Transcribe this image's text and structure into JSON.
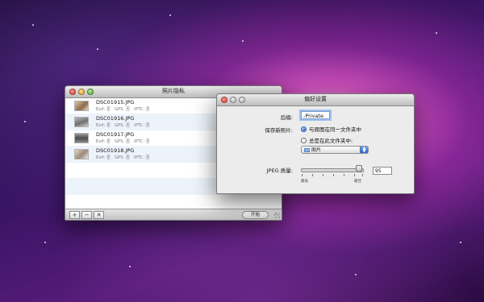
{
  "main_window": {
    "title": "照片隐私",
    "items": [
      {
        "filename": "DSC01915.JPG",
        "exif": "Exif: 否",
        "gps": "GPS: 否",
        "iptc": "IPTC: 否"
      },
      {
        "filename": "DSC01916.JPG",
        "exif": "Exif: 否",
        "gps": "GPS: 否",
        "iptc": "IPTC: 否"
      },
      {
        "filename": "DSC01917.JPG",
        "exif": "Exif: 否",
        "gps": "GPS: 否",
        "iptc": "IPTC: 否"
      },
      {
        "filename": "DSC01918.JPG",
        "exif": "Exif: 否",
        "gps": "GPS: 否",
        "iptc": "IPTC: 否"
      }
    ],
    "toolbar": {
      "add_label": "+",
      "remove_label": "−",
      "clear_label": "✕",
      "start_label": "开始"
    }
  },
  "prefs_window": {
    "title": "偏好设置",
    "suffix_label": "后缀:",
    "suffix_value": "-Private",
    "save_label": "保存新照片:",
    "option_same": "与原图在同一文件夹中",
    "option_always": "总是在此文件夹中:",
    "folder_value": "图片",
    "jpeg_label": "JPEG 质量:",
    "jpeg_value": "95",
    "jpeg_quality_fraction": 0.95,
    "range_low": "最低",
    "range_high": "最佳"
  },
  "icons": {
    "close": "close-icon",
    "minimize": "minimize-icon",
    "zoom": "zoom-icon",
    "folder": "folder-icon",
    "resize": "resize-grip-icon"
  },
  "colors": {
    "selection_blue": "#3a7be0",
    "focus_ring": "#9cc1ef",
    "row_alt": "#edf3fb"
  }
}
